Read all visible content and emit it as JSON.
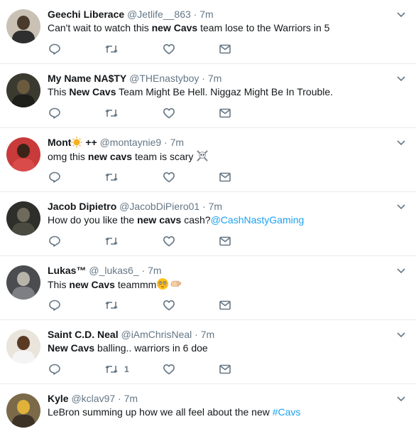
{
  "tweets": [
    {
      "name": "Geechi Liberace",
      "handle": "@Jetlife__863",
      "dot": "·",
      "time": "7m",
      "text_parts": [
        {
          "t": "Can't wait to watch this ",
          "s": "plain"
        },
        {
          "t": "new Cavs",
          "s": "bold"
        },
        {
          "t": " team lose to the Warriors in 5",
          "s": "plain"
        }
      ],
      "reply_count": "",
      "retweet_count": "",
      "like_count": ""
    },
    {
      "name": "My Name NA$TY",
      "handle": "@THEnastyboy",
      "dot": "·",
      "time": "7m",
      "text_parts": [
        {
          "t": "This ",
          "s": "plain"
        },
        {
          "t": "New Cavs",
          "s": "bold"
        },
        {
          "t": " Team Might Be Hell. Niggaz Might Be In Trouble.",
          "s": "plain"
        }
      ],
      "reply_count": "",
      "retweet_count": "",
      "like_count": ""
    },
    {
      "name": "Mont",
      "name_suffix": "++",
      "handle": "@montaynie9",
      "dot": "·",
      "time": "7m",
      "text_parts": [
        {
          "t": "omg this ",
          "s": "plain"
        },
        {
          "t": "new cavs",
          "s": "bold"
        },
        {
          "t": " team is scary",
          "s": "plain"
        }
      ],
      "emoji": "skull-crossbones",
      "name_emoji": "sun-face",
      "reply_count": "",
      "retweet_count": "",
      "like_count": ""
    },
    {
      "name": "Jacob Dipietro",
      "handle": "@JacobDiPiero01",
      "dot": "·",
      "time": "7m",
      "text_parts": [
        {
          "t": "How do you like the ",
          "s": "plain"
        },
        {
          "t": "new cavs",
          "s": "bold"
        },
        {
          "t": " cash?",
          "s": "plain"
        },
        {
          "t": "@CashNastyGaming",
          "s": "link"
        }
      ],
      "reply_count": "",
      "retweet_count": "",
      "like_count": ""
    },
    {
      "name": "Lukas™",
      "handle": "@_lukas6_",
      "dot": "·",
      "time": "7m",
      "text_parts": [
        {
          "t": "This ",
          "s": "plain"
        },
        {
          "t": "new Cavs",
          "s": "bold"
        },
        {
          "t": " teammm",
          "s": "plain"
        }
      ],
      "emoji": "flushed-face-and-hand",
      "reply_count": "",
      "retweet_count": "",
      "like_count": ""
    },
    {
      "name": "Saint C.D. Neal",
      "handle": "@iAmChrisNeal",
      "dot": "·",
      "time": "7m",
      "text_parts": [
        {
          "t": "New Cavs",
          "s": "bold"
        },
        {
          "t": " balling.. warriors in 6 doe",
          "s": "plain"
        }
      ],
      "reply_count": "",
      "retweet_count": "1",
      "like_count": ""
    },
    {
      "name": "Kyle",
      "handle": "@kclav97",
      "dot": "·",
      "time": "7m",
      "text_parts": [
        {
          "t": "LeBron summing up how we all feel about the new ",
          "s": "plain"
        },
        {
          "t": "#Cavs",
          "s": "link"
        }
      ],
      "reply_count": "",
      "retweet_count": "",
      "like_count": ""
    }
  ],
  "icons": {
    "reply": "reply-icon",
    "retweet": "retweet-icon",
    "like": "like-icon",
    "dm": "direct-message-icon",
    "more": "chevron-down-icon"
  },
  "colors": {
    "text": "#14171a",
    "muted": "#657786",
    "link": "#1da1f2",
    "border": "#e6ecf0"
  }
}
